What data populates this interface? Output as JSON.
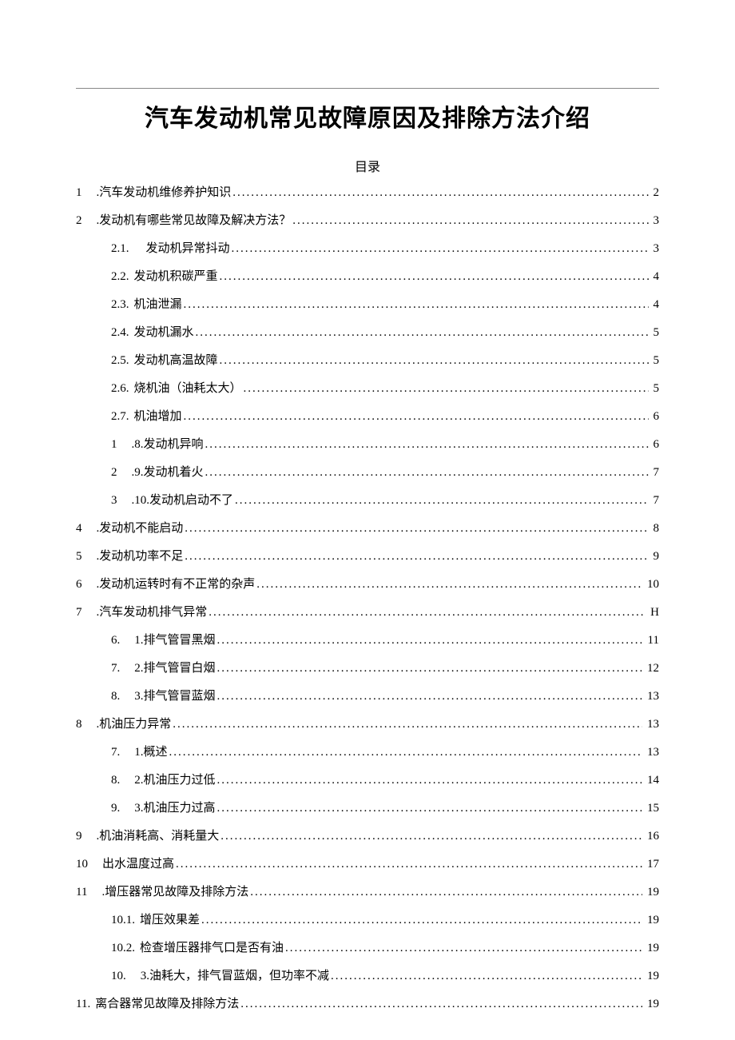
{
  "title": "汽车发动机常见故障原因及排除方法介绍",
  "toc_heading": "目录",
  "entries": [
    {
      "level": 1,
      "num": "1",
      "label": ".汽车发动机维修养护知识",
      "page": "2",
      "gap": true
    },
    {
      "level": 1,
      "num": "2",
      "label": ".发动机有哪些常见故障及解决方法？",
      "page": "3",
      "gap": true
    },
    {
      "level": 2,
      "num": "2.1.",
      "label": "　发动机异常抖动",
      "page": "3",
      "gap": false
    },
    {
      "level": 2,
      "num": "2.2.",
      "label": "发动机积碳严重",
      "page": "4",
      "gap": false
    },
    {
      "level": 2,
      "num": "2.3.",
      "label": "机油泄漏",
      "page": "4",
      "gap": false
    },
    {
      "level": 2,
      "num": "2.4.",
      "label": "发动机漏水",
      "page": "5",
      "gap": false
    },
    {
      "level": 2,
      "num": "2.5.",
      "label": "发动机高温故障",
      "page": "5",
      "gap": false
    },
    {
      "level": 2,
      "num": "2.6.",
      "label": "烧机油（油耗太大）",
      "page": "5",
      "gap": false
    },
    {
      "level": 2,
      "num": "2.7.",
      "label": "机油增加",
      "page": "6",
      "gap": false
    },
    {
      "level": 2,
      "num": "1",
      "label": ".8.发动机异响",
      "page": "6",
      "gap": true
    },
    {
      "level": 2,
      "num": "2",
      "label": ".9.发动机着火",
      "page": "7",
      "gap": true
    },
    {
      "level": 2,
      "num": "3",
      "label": ".10.发动机启动不了",
      "page": "7",
      "gap": true
    },
    {
      "level": 1,
      "num": "4",
      "label": ".发动机不能启动",
      "page": "8",
      "gap": true
    },
    {
      "level": 1,
      "num": "5",
      "label": ".发动机功率不足",
      "page": "9",
      "gap": true
    },
    {
      "level": 1,
      "num": "6",
      "label": ".发动机运转时有不正常的杂声",
      "page": "10",
      "gap": true
    },
    {
      "level": 1,
      "num": "7",
      "label": ".汽车发动机排气异常",
      "page": "H",
      "gap": true
    },
    {
      "level": 2,
      "num": "6.",
      "label": "1.排气管冒黑烟",
      "page": "11",
      "gap": true
    },
    {
      "level": 2,
      "num": "7.",
      "label": "2.排气管冒白烟",
      "page": "12",
      "gap": true
    },
    {
      "level": 2,
      "num": "8.",
      "label": "3.排气管冒蓝烟",
      "page": "13",
      "gap": true
    },
    {
      "level": 1,
      "num": "8",
      "label": ".机油压力异常",
      "page": "13",
      "gap": true
    },
    {
      "level": 2,
      "num": "7.",
      "label": "1.概述",
      "page": "13",
      "gap": true
    },
    {
      "level": 2,
      "num": "8.",
      "label": "2.机油压力过低",
      "page": "14",
      "gap": true
    },
    {
      "level": 2,
      "num": "9.",
      "label": "3.机油压力过高",
      "page": "15",
      "gap": true
    },
    {
      "level": 1,
      "num": "9",
      "label": ".机油消耗高、消耗量大",
      "page": "16",
      "gap": true
    },
    {
      "level": 1,
      "num": "10",
      "label": "出水温度过高",
      "page": "17",
      "gap": true
    },
    {
      "level": 1,
      "num": "11",
      "label": ".增压器常见故障及排除方法",
      "page": "19",
      "gap": true
    },
    {
      "level": 2,
      "num": "10.1.",
      "label": "增压效果差",
      "page": "19",
      "gap": false
    },
    {
      "level": 2,
      "num": "10.2.",
      "label": "检查增压器排气口是否有油",
      "page": "19",
      "gap": false
    },
    {
      "level": 2,
      "num": "10.",
      "label": "3.油耗大，排气冒蓝烟，但功率不减",
      "page": "19",
      "gap": true
    },
    {
      "level": 1,
      "num": "11.",
      "label": "离合器常见故障及排除方法",
      "page": "19",
      "gap": false
    }
  ]
}
